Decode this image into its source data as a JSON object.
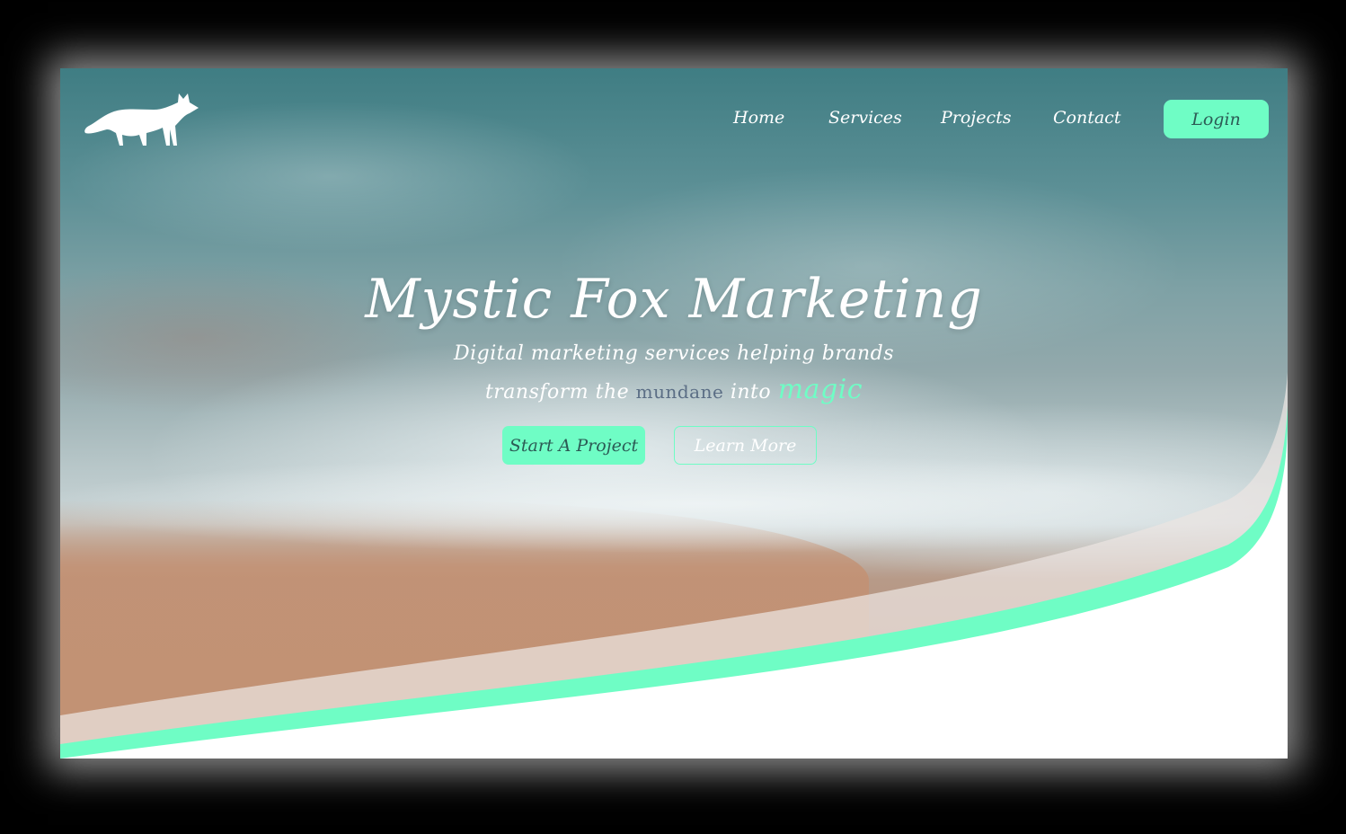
{
  "brand": {
    "logo_icon": "fox-icon"
  },
  "nav": {
    "links": [
      {
        "label": "Home"
      },
      {
        "label": "Services"
      },
      {
        "label": "Projects"
      },
      {
        "label": "Contact"
      }
    ],
    "login_label": "Login"
  },
  "hero": {
    "title": "Mystic Fox Marketing",
    "subtitle_line1": "Digital marketing services helping brands",
    "subtitle_pre": "transform the ",
    "subtitle_mundane": "mundane",
    "subtitle_mid": " into ",
    "subtitle_magic": "magic",
    "primary_cta": "Start A Project",
    "secondary_cta": "Learn More"
  },
  "colors": {
    "accent": "#6ffdc5",
    "button_text": "#2c5b55",
    "mundane_text": "#5b6e85",
    "background": "#000000"
  }
}
